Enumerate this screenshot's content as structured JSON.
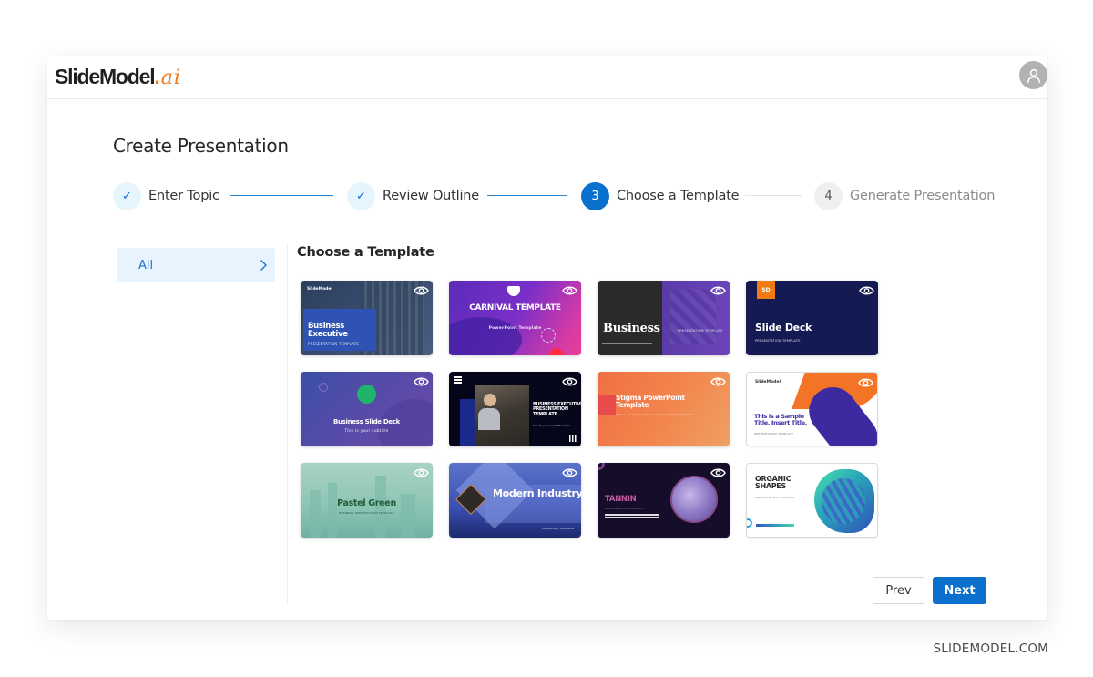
{
  "app": {
    "logo_main": "SlideModel",
    "logo_dot": ".",
    "logo_suffix": "ai",
    "avatar_icon": "user-icon"
  },
  "page": {
    "title": "Create Presentation"
  },
  "stepper": {
    "steps": [
      {
        "marker": "✓",
        "label": "Enter Topic",
        "state": "done"
      },
      {
        "marker": "✓",
        "label": "Review Outline",
        "state": "done"
      },
      {
        "marker": "3",
        "label": "Choose a Template",
        "state": "active"
      },
      {
        "marker": "4",
        "label": "Generate Presentation",
        "state": "pending"
      }
    ]
  },
  "sidebar": {
    "items": [
      {
        "label": "All",
        "selected": true,
        "icon": "chevron-right-icon"
      }
    ]
  },
  "templates": {
    "heading": "Choose a Template",
    "preview_icon": "eye-icon",
    "items": [
      {
        "title": "Business Executive",
        "subtitle": "PRESENTATION TEMPLATE",
        "brand": "SlideModel"
      },
      {
        "title": "CARNIVAL TEMPLATE",
        "subtitle": "PowerPoint Template"
      },
      {
        "title": "Business",
        "subtitle": "PRESENTATION TEMPLATE"
      },
      {
        "title": "Slide Deck",
        "subtitle": "PRESENTATION TEMPLATE",
        "badge": "SD"
      },
      {
        "title": "Business Slide Deck",
        "subtitle": "This is your subtitle"
      },
      {
        "title": "BUSINESS EXECUTIVE PRESENTATION TEMPLATE",
        "subtitle": "Insert your subtitle here"
      },
      {
        "title": "Stigma PowerPoint Template",
        "subtitle": "This is a sample text insert your desired text here"
      },
      {
        "title": "This is a Sample Title. Insert Title.",
        "subtitle": "PRESENTATION TEMPLATE",
        "brand": "SlideModel"
      },
      {
        "title": "Pastel Green",
        "subtitle": "BUSINESS PRESENTATION TEMPLATE"
      },
      {
        "title": "Modern Industry",
        "subtitle": "PowerPoint Template"
      },
      {
        "title": "TANNIN",
        "subtitle": "PRESENTATION TEMPLATE"
      },
      {
        "title": "ORGANIC SHAPES",
        "subtitle": "PRESENTATION TEMPLATE"
      }
    ]
  },
  "footer": {
    "prev_label": "Prev",
    "next_label": "Next"
  },
  "watermark": "SLIDEMODEL.COM",
  "colors": {
    "accent": "#0b6fce",
    "step_done_bg": "#e6f4fd",
    "sidebar_selected_bg": "#e7f4fd",
    "logo_ai": "#f07a1e"
  }
}
